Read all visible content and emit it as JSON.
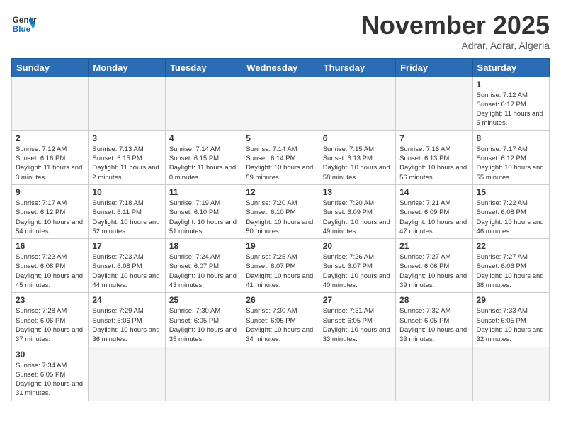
{
  "logo": {
    "line1": "General",
    "line2": "Blue"
  },
  "title": "November 2025",
  "subtitle": "Adrar, Adrar, Algeria",
  "days_of_week": [
    "Sunday",
    "Monday",
    "Tuesday",
    "Wednesday",
    "Thursday",
    "Friday",
    "Saturday"
  ],
  "weeks": [
    [
      {
        "day": "",
        "info": ""
      },
      {
        "day": "",
        "info": ""
      },
      {
        "day": "",
        "info": ""
      },
      {
        "day": "",
        "info": ""
      },
      {
        "day": "",
        "info": ""
      },
      {
        "day": "",
        "info": ""
      },
      {
        "day": "1",
        "info": "Sunrise: 7:12 AM\nSunset: 6:17 PM\nDaylight: 11 hours and 5 minutes."
      }
    ],
    [
      {
        "day": "2",
        "info": "Sunrise: 7:12 AM\nSunset: 6:16 PM\nDaylight: 11 hours and 3 minutes."
      },
      {
        "day": "3",
        "info": "Sunrise: 7:13 AM\nSunset: 6:15 PM\nDaylight: 11 hours and 2 minutes."
      },
      {
        "day": "4",
        "info": "Sunrise: 7:14 AM\nSunset: 6:15 PM\nDaylight: 11 hours and 0 minutes."
      },
      {
        "day": "5",
        "info": "Sunrise: 7:14 AM\nSunset: 6:14 PM\nDaylight: 10 hours and 59 minutes."
      },
      {
        "day": "6",
        "info": "Sunrise: 7:15 AM\nSunset: 6:13 PM\nDaylight: 10 hours and 58 minutes."
      },
      {
        "day": "7",
        "info": "Sunrise: 7:16 AM\nSunset: 6:13 PM\nDaylight: 10 hours and 56 minutes."
      },
      {
        "day": "8",
        "info": "Sunrise: 7:17 AM\nSunset: 6:12 PM\nDaylight: 10 hours and 55 minutes."
      }
    ],
    [
      {
        "day": "9",
        "info": "Sunrise: 7:17 AM\nSunset: 6:12 PM\nDaylight: 10 hours and 54 minutes."
      },
      {
        "day": "10",
        "info": "Sunrise: 7:18 AM\nSunset: 6:11 PM\nDaylight: 10 hours and 52 minutes."
      },
      {
        "day": "11",
        "info": "Sunrise: 7:19 AM\nSunset: 6:10 PM\nDaylight: 10 hours and 51 minutes."
      },
      {
        "day": "12",
        "info": "Sunrise: 7:20 AM\nSunset: 6:10 PM\nDaylight: 10 hours and 50 minutes."
      },
      {
        "day": "13",
        "info": "Sunrise: 7:20 AM\nSunset: 6:09 PM\nDaylight: 10 hours and 49 minutes."
      },
      {
        "day": "14",
        "info": "Sunrise: 7:21 AM\nSunset: 6:09 PM\nDaylight: 10 hours and 47 minutes."
      },
      {
        "day": "15",
        "info": "Sunrise: 7:22 AM\nSunset: 6:08 PM\nDaylight: 10 hours and 46 minutes."
      }
    ],
    [
      {
        "day": "16",
        "info": "Sunrise: 7:23 AM\nSunset: 6:08 PM\nDaylight: 10 hours and 45 minutes."
      },
      {
        "day": "17",
        "info": "Sunrise: 7:23 AM\nSunset: 6:08 PM\nDaylight: 10 hours and 44 minutes."
      },
      {
        "day": "18",
        "info": "Sunrise: 7:24 AM\nSunset: 6:07 PM\nDaylight: 10 hours and 43 minutes."
      },
      {
        "day": "19",
        "info": "Sunrise: 7:25 AM\nSunset: 6:07 PM\nDaylight: 10 hours and 41 minutes."
      },
      {
        "day": "20",
        "info": "Sunrise: 7:26 AM\nSunset: 6:07 PM\nDaylight: 10 hours and 40 minutes."
      },
      {
        "day": "21",
        "info": "Sunrise: 7:27 AM\nSunset: 6:06 PM\nDaylight: 10 hours and 39 minutes."
      },
      {
        "day": "22",
        "info": "Sunrise: 7:27 AM\nSunset: 6:06 PM\nDaylight: 10 hours and 38 minutes."
      }
    ],
    [
      {
        "day": "23",
        "info": "Sunrise: 7:28 AM\nSunset: 6:06 PM\nDaylight: 10 hours and 37 minutes."
      },
      {
        "day": "24",
        "info": "Sunrise: 7:29 AM\nSunset: 6:06 PM\nDaylight: 10 hours and 36 minutes."
      },
      {
        "day": "25",
        "info": "Sunrise: 7:30 AM\nSunset: 6:05 PM\nDaylight: 10 hours and 35 minutes."
      },
      {
        "day": "26",
        "info": "Sunrise: 7:30 AM\nSunset: 6:05 PM\nDaylight: 10 hours and 34 minutes."
      },
      {
        "day": "27",
        "info": "Sunrise: 7:31 AM\nSunset: 6:05 PM\nDaylight: 10 hours and 33 minutes."
      },
      {
        "day": "28",
        "info": "Sunrise: 7:32 AM\nSunset: 6:05 PM\nDaylight: 10 hours and 33 minutes."
      },
      {
        "day": "29",
        "info": "Sunrise: 7:33 AM\nSunset: 6:05 PM\nDaylight: 10 hours and 32 minutes."
      }
    ],
    [
      {
        "day": "30",
        "info": "Sunrise: 7:34 AM\nSunset: 6:05 PM\nDaylight: 10 hours and 31 minutes."
      },
      {
        "day": "",
        "info": ""
      },
      {
        "day": "",
        "info": ""
      },
      {
        "day": "",
        "info": ""
      },
      {
        "day": "",
        "info": ""
      },
      {
        "day": "",
        "info": ""
      },
      {
        "day": "",
        "info": ""
      }
    ]
  ]
}
